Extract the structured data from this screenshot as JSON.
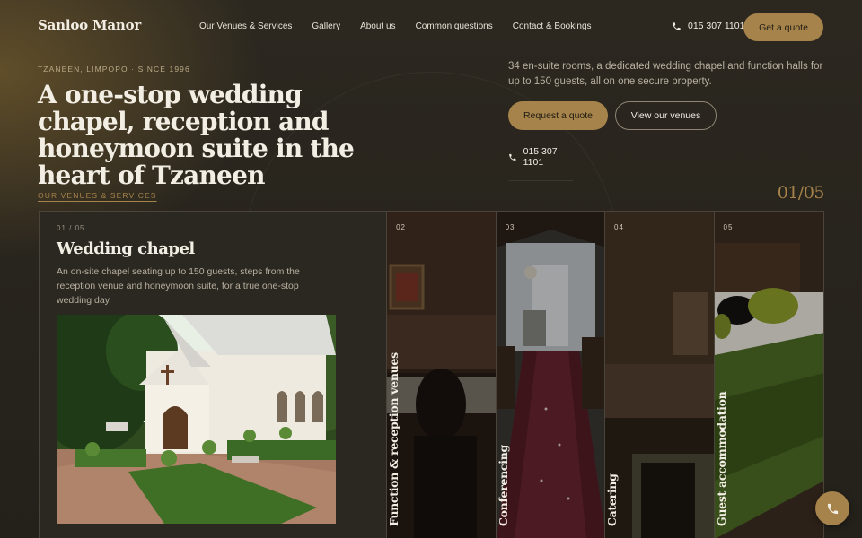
{
  "header": {
    "logo": "Sanloo Manor",
    "nav": [
      {
        "label": "Our Venues & Services"
      },
      {
        "label": "Gallery"
      },
      {
        "label": "About us"
      },
      {
        "label": "Common questions"
      },
      {
        "label": "Contact & Bookings"
      }
    ],
    "phone": "015 307 1101",
    "cta_label": "Get a quote"
  },
  "hero": {
    "eyebrow": "TZANEEN, LIMPOPO · SINCE 1996",
    "headline": "A one-stop wedding chapel, reception and honeymoon suite in the heart of Tzaneen",
    "lead": "34 en-suite rooms, a dedicated wedding chapel and function halls for up to 150 guests, all on one secure property.",
    "primary_button": "Request a quote",
    "secondary_button": "View our venues",
    "phone": "015 307 1101"
  },
  "venues": {
    "section_label": "OUR VENUES & SERVICES",
    "counter": "01/05",
    "active": {
      "number": "01 / 05",
      "title": "Wedding chapel",
      "description": "An on-site chapel seating up to 150 guests, steps from the reception venue and honeymoon suite, for a true one-stop wedding day."
    },
    "strips": [
      {
        "number": "02",
        "label": "Function & reception venues"
      },
      {
        "number": "03",
        "label": "Conferencing"
      },
      {
        "number": "04",
        "label": "Catering"
      },
      {
        "number": "05",
        "label": "Guest accommodation"
      }
    ]
  },
  "colors": {
    "accent": "#a6834a",
    "background": "#26231d",
    "text": "#f3eee3"
  },
  "icons": {
    "phone": "phone-icon"
  }
}
